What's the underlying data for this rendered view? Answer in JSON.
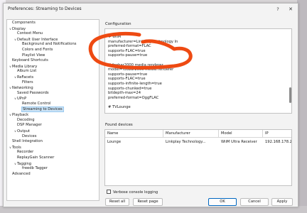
{
  "window": {
    "title": "Preferences: Streaming to Devices",
    "help_label": "?",
    "close_label": "✕"
  },
  "tree": [
    {
      "label": "Components",
      "level": 0,
      "toggle": ""
    },
    {
      "label": "Display",
      "level": 0,
      "toggle": "∨"
    },
    {
      "label": "Context Menu",
      "level": 1,
      "toggle": ""
    },
    {
      "label": "Default User Interface",
      "level": 1,
      "toggle": "∨"
    },
    {
      "label": "Background and Notifications",
      "level": 2,
      "toggle": ""
    },
    {
      "label": "Colors and Fonts",
      "level": 2,
      "toggle": ""
    },
    {
      "label": "Playlist View",
      "level": 2,
      "toggle": ""
    },
    {
      "label": "Keyboard Shortcuts",
      "level": 0,
      "toggle": ""
    },
    {
      "label": "Media Library",
      "level": 0,
      "toggle": "∨"
    },
    {
      "label": "Album List",
      "level": 1,
      "toggle": ""
    },
    {
      "label": "ReFacets",
      "level": 1,
      "toggle": "∨"
    },
    {
      "label": "Filters",
      "level": 2,
      "toggle": ""
    },
    {
      "label": "Networking",
      "level": 0,
      "toggle": "∨"
    },
    {
      "label": "Saved Passwords",
      "level": 1,
      "toggle": ""
    },
    {
      "label": "UPnP",
      "level": 1,
      "toggle": "∨"
    },
    {
      "label": "Remote Control",
      "level": 2,
      "toggle": ""
    },
    {
      "label": "Streaming to Devices",
      "level": 2,
      "toggle": "",
      "selected": true
    },
    {
      "label": "Playback",
      "level": 0,
      "toggle": "∨"
    },
    {
      "label": "Decoding",
      "level": 1,
      "toggle": ""
    },
    {
      "label": "DSP Manager",
      "level": 1,
      "toggle": ""
    },
    {
      "label": "Output",
      "level": 1,
      "toggle": "∨"
    },
    {
      "label": "Devices",
      "level": 2,
      "toggle": ""
    },
    {
      "label": "Shell Integration",
      "level": 0,
      "toggle": ""
    },
    {
      "label": "Tools",
      "level": 0,
      "toggle": "∨"
    },
    {
      "label": "Recorder",
      "level": 1,
      "toggle": ""
    },
    {
      "label": "ReplayGain Scanner",
      "level": 1,
      "toggle": ""
    },
    {
      "label": "Tagging",
      "level": 1,
      "toggle": "∨"
    },
    {
      "label": "freedb Tagger",
      "level": 2,
      "toggle": ""
    },
    {
      "label": "Advanced",
      "level": 0,
      "toggle": ""
    }
  ],
  "configuration": {
    "label": "Configuration",
    "lines": [
      "# WiiM",
      "manufacturer=Linkplay Technology In",
      "preferred-format=FLAC",
      "supports-FLAC=true",
      "supports-pause=true",
      "",
      "# foobar2000 media renderer",
      "model=foobar2000 media renderer",
      "supports-pause=true",
      "supports-FLAC=true",
      "supports-infinite-length=true",
      "supports-chunked=true",
      "bitdepth-max=24",
      "preferred-format=OggFLAC",
      "",
      "# TVLounge"
    ],
    "highlight_color": "#ee4a12"
  },
  "found_devices": {
    "label": "Found devices",
    "columns": [
      "Name",
      "Manufacturer",
      "Model",
      "IP"
    ],
    "rows": [
      [
        "Lounge",
        "Linkplay Technology...",
        "WiiM Ultra Receiver",
        "192.168.178.23"
      ]
    ]
  },
  "verbose_logging": {
    "label": "Verbose console logging",
    "checked": false
  },
  "buttons": {
    "reset_all": "Reset all",
    "reset_page": "Reset page",
    "ok": "OK",
    "cancel": "Cancel",
    "apply": "Apply"
  },
  "colors": {
    "accent": "#0067c0",
    "selection": "#cce4f7"
  }
}
